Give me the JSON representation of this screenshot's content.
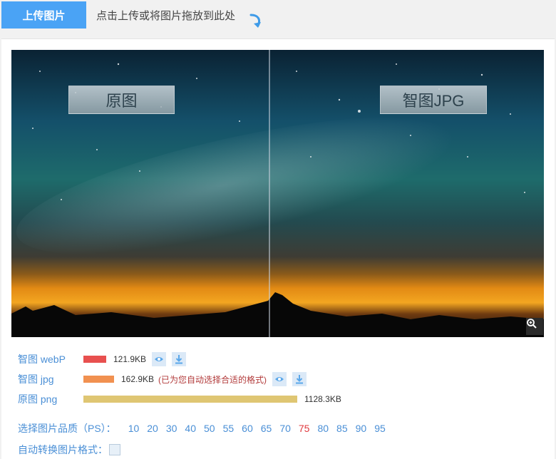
{
  "header": {
    "upload_label": "上传图片",
    "hint": "点击上传或将图片拖放到此处"
  },
  "viewer": {
    "left_tag": "原图",
    "right_tag": "智图JPG"
  },
  "formats": [
    {
      "label": "智图 webP",
      "size": "121.9KB",
      "color": "#e8504f",
      "has_actions": true,
      "note": ""
    },
    {
      "label": "智图 jpg",
      "size": "162.9KB",
      "color": "#f19150",
      "has_actions": true,
      "note": "(已为您自动选择合适的格式)"
    },
    {
      "label": "原图 png",
      "size": "1128.3KB",
      "color": "#dfc673",
      "has_actions": false,
      "note": ""
    }
  ],
  "quality": {
    "label": "选择图片品质（PS）：",
    "options": [
      "10",
      "20",
      "30",
      "40",
      "50",
      "55",
      "60",
      "65",
      "70",
      "75",
      "80",
      "85",
      "90",
      "95"
    ],
    "selected": "75"
  },
  "auto_convert": {
    "label": "自动转换图片格式：",
    "checked": false
  },
  "icons": {
    "arrow": "curved-arrow-icon",
    "zoom": "zoom-in-icon",
    "preview": "eye-icon",
    "download": "download-icon"
  },
  "colors": {
    "accent": "#4aa3f5",
    "link": "#4a8fd6",
    "selected": "#e0393e"
  }
}
